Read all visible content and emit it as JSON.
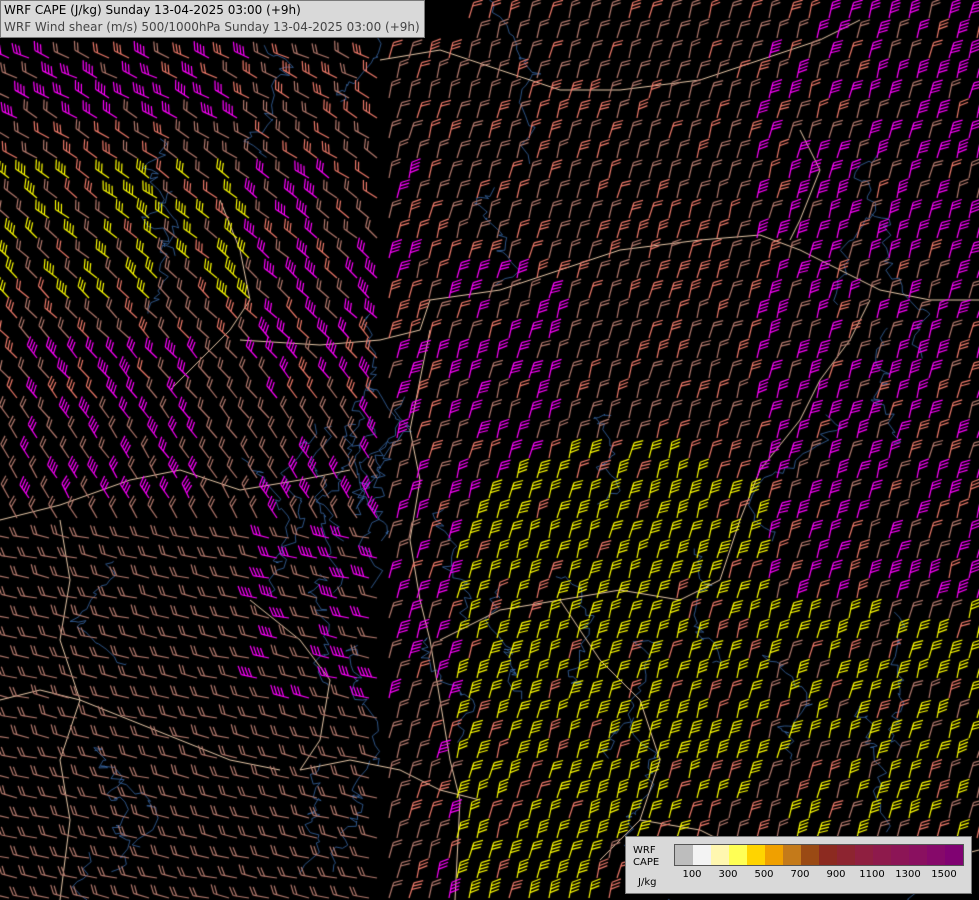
{
  "header": {
    "line1": "WRF CAPE (J/kg) Sunday 13-04-2025 03:00 (+9h)",
    "line2": "WRF Wind shear (m/s) 500/1000hPa Sunday 13-04-2025 03:00 (+9h)"
  },
  "legend": {
    "title_line1": "WRF",
    "title_line2": "CAPE",
    "units": "J/kg",
    "swatch_colors": [
      "#bdbdbd",
      "#f3f3f3",
      "#fff7b0",
      "#ffff55",
      "#ffd400",
      "#f0a000",
      "#c47a1a",
      "#9a4a14",
      "#8c2a20",
      "#8d2430",
      "#8f1f40",
      "#8e1a4c",
      "#8c1556",
      "#8a1060",
      "#86096a",
      "#800272"
    ],
    "tick_labels": [
      "100",
      "300",
      "500",
      "700",
      "900",
      "1100",
      "1300",
      "1500"
    ]
  },
  "colors": {
    "background": "#000000",
    "wind_barb_low": "#b57a6e",
    "wind_barb_mid": "#ef7a6a",
    "wind_barb_high": "#ff00ff",
    "wind_barb_yellow": "#ffff00",
    "borders": "#e8c8a8",
    "rivers": "#3a6aa8"
  }
}
